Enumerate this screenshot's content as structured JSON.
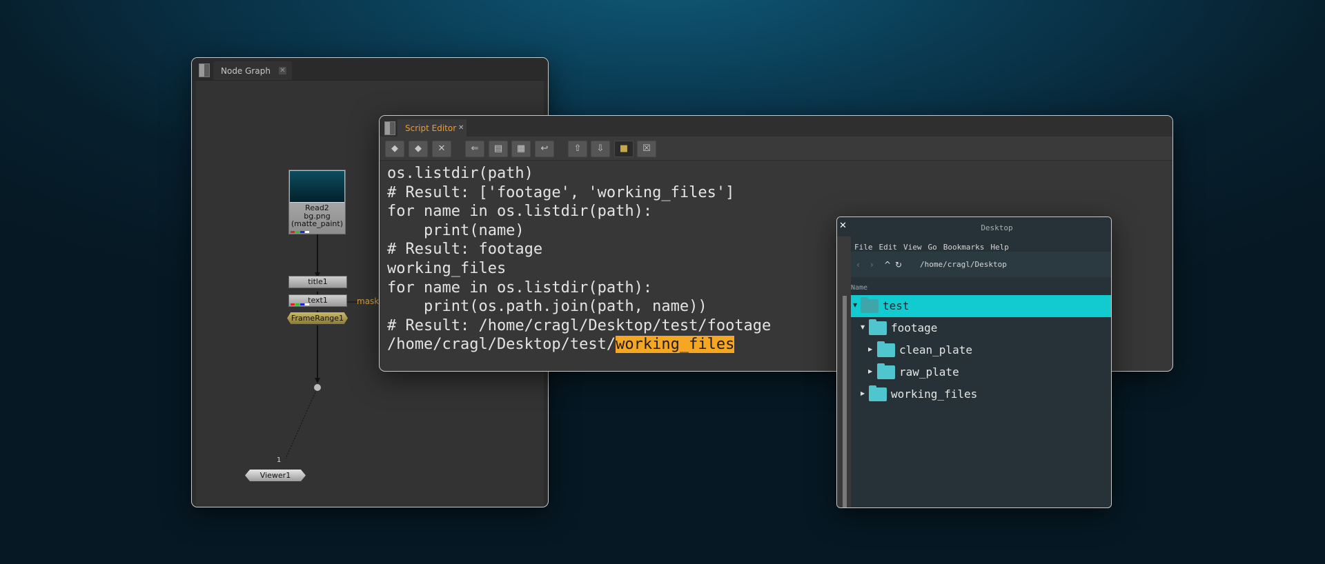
{
  "node_graph": {
    "tab_label": "Node Graph",
    "tab_close": "✕",
    "nodes": {
      "read": {
        "line1": "Read2",
        "line2": "bg.png",
        "line3": "(matte_paint)"
      },
      "title": "title1",
      "text": "text1",
      "mask_label": "mask",
      "framerange": "FrameRange1",
      "viewer": "Viewer1",
      "viewer_input": "1"
    }
  },
  "script_editor": {
    "tab_label": "Script Editor",
    "tab_close": "✕",
    "toolbar_icons": [
      "previous-script-icon",
      "next-script-icon",
      "clear-history-icon",
      "source-script-icon",
      "load-script-icon",
      "save-script-icon",
      "run-script-icon",
      "show-input-icon",
      "show-output-icon",
      "show-both-icon",
      "clear-output-icon"
    ],
    "code_lines": [
      "os.listdir(path)",
      "# Result: ['footage', 'working_files']",
      "for name in os.listdir(path):",
      "    print(name)",
      "# Result: footage",
      "working_files",
      "for name in os.listdir(path):",
      "    print(os.path.join(path, name))",
      "# Result: /home/cragl/Desktop/test/footage",
      "/home/cragl/Desktop/test/"
    ],
    "highlighted": "working_files"
  },
  "file_browser": {
    "title": "Desktop",
    "close": "✕",
    "menu": [
      "File",
      "Edit",
      "View",
      "Go",
      "Bookmarks",
      "Help"
    ],
    "path": "/home/cragl/Desktop",
    "column_header": "Name",
    "tree": [
      {
        "name": "test",
        "expanded": true,
        "selected": true
      },
      {
        "name": "footage",
        "expanded": true,
        "selected": false
      },
      {
        "name": "clean_plate",
        "expanded": false,
        "selected": false
      },
      {
        "name": "raw_plate",
        "expanded": false,
        "selected": false
      },
      {
        "name": "working_files",
        "expanded": false,
        "selected": false
      }
    ],
    "selection_color": "#12cbd1",
    "folder_color": "#4fc6cd"
  }
}
